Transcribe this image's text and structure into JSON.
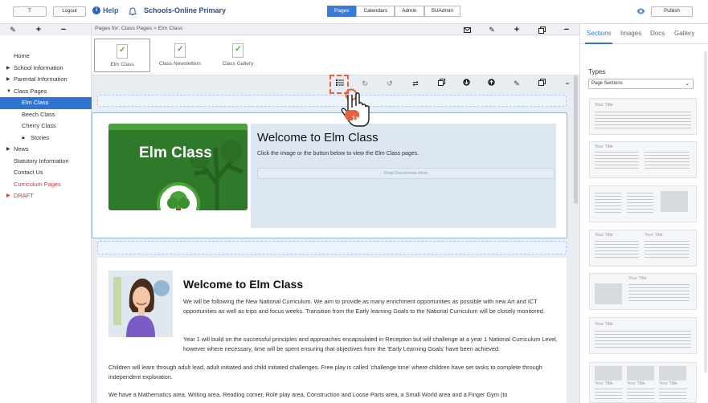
{
  "topbar": {
    "user_button": "T",
    "logout_label": "Logout",
    "help_label": "Help",
    "school_name": "Schools-Online Primary",
    "nav_tabs": [
      "Pages",
      "Calendars",
      "Admin",
      "SUAdmin"
    ],
    "publish_label": "Publish"
  },
  "tree": [
    {
      "label": "Home",
      "level": 1,
      "arrow": "",
      "selected": false,
      "red": false
    },
    {
      "label": "School Information",
      "level": 1,
      "arrow": "right",
      "selected": false,
      "red": false
    },
    {
      "label": "Parental Information",
      "level": 1,
      "arrow": "right",
      "selected": false,
      "red": false
    },
    {
      "label": "Class Pages",
      "level": 1,
      "arrow": "down",
      "selected": false,
      "red": false
    },
    {
      "label": "Elm Class",
      "level": 2,
      "arrow": "",
      "selected": true,
      "red": false
    },
    {
      "label": "Beech Class",
      "level": 2,
      "arrow": "",
      "selected": false,
      "red": false
    },
    {
      "label": "Cherry Class",
      "level": 2,
      "arrow": "",
      "selected": false,
      "red": false
    },
    {
      "label": "Stories",
      "level": 2,
      "arrow": "lock",
      "selected": false,
      "red": false
    },
    {
      "label": "News",
      "level": 1,
      "arrow": "right",
      "selected": false,
      "red": false
    },
    {
      "label": "Statutory Information",
      "level": 1,
      "arrow": "",
      "selected": false,
      "red": false
    },
    {
      "label": "Contact Us",
      "level": 1,
      "arrow": "",
      "selected": false,
      "red": false
    },
    {
      "label": "Curriculum Pages",
      "level": 1,
      "arrow": "",
      "selected": false,
      "red": true
    },
    {
      "label": "DRAFT",
      "level": 1,
      "arrow": "right",
      "selected": false,
      "red": true
    }
  ],
  "main": {
    "breadcrumb": "Pages for: Class Pages > Elm Class",
    "pages": [
      "Elm Class",
      "Class Newsletters",
      "Class Gallery"
    ],
    "click_badge": "1x",
    "section1": {
      "image_title": "Elm Class",
      "heading": "Welcome to Elm Class",
      "text": "Click the image or the button below to view the Elm Class pages.",
      "drop_label": "Drop Documents Here"
    },
    "section3": {
      "heading": "Welcome to Elm Class",
      "para1": "We will be following the New National Curriculum. We aim to provide as many enrichment opportunities as possible with new Art and ICT opportunities as well as trips and focus weeks.  Transition from the Early learning Goals to the National Curriculum will be closely monitored.",
      "para2": "Year 1 will build on the successful principles and approaches encapsulated in Reception but will challenge at a year 1 National Curriculum Level, however where necessary, time will be spent ensuring that objectives from the 'Early Learning Goals' have been achieved.",
      "para3": "Children will learn through adult lead, adult initiated and child initiated challenges. Free play is called 'challenge time' where children have set tasks to complete through independent exploration.",
      "para4": "We have a Mathematics area, Writing area, Reading corner, Role play area, Construction and Loose Parts area, a Small World area and a Finger Gym (to"
    }
  },
  "right": {
    "tabs": [
      "Sections",
      "Images",
      "Docs",
      "Gallery"
    ],
    "types_label": "Types",
    "types_value": "Page Sections",
    "layout_title": "Your Title"
  },
  "colors": {
    "accent": "#2f74d0",
    "highlight": "#e8603c",
    "brand_green": "#2f7a2a"
  }
}
